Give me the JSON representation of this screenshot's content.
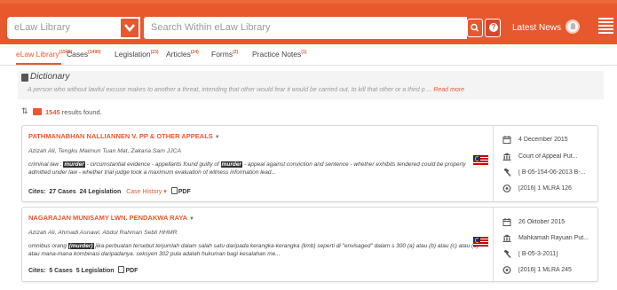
{
  "header": {
    "library_select": "eLaw Library",
    "search_placeholder": "Search Within eLaw Library",
    "latest_news": "Latest News",
    "colors": {
      "brand": "#e8582e"
    }
  },
  "tabs": [
    {
      "label": "eLaw Library",
      "count": "(1545)"
    },
    {
      "label": "Cases",
      "count": "(1490)"
    },
    {
      "label": "Legislation",
      "count": "(23)"
    },
    {
      "label": "Articles",
      "count": "(24)"
    },
    {
      "label": "Forms",
      "count": "(2)"
    },
    {
      "label": "Practice Notes",
      "count": "(1)"
    }
  ],
  "dictionary": {
    "title": "Dictionary",
    "text": "A person who without lawful excuse makes to another a threat, intending that other would fear it would be carried out, to kill that other or a third p ...",
    "read_more": "Read more"
  },
  "results": {
    "count": "1545",
    "suffix": "results found."
  },
  "cards": [
    {
      "title": "PATHMANABHAN NALLIANNEN V. PP & OTHER APPEALS",
      "judges": "Azizah Ali, Tengku Maimun Tuan Mat, Zakaria Sam JJCA",
      "snippet_parts": [
        "criminal law : ",
        "murder",
        " - circumstantial evidence - appellants found guilty of ",
        "murder",
        " - appeal against conviction and sentence - whether exhibits tendered could be properly admitted under law - whether trial judge took a maximum evaluation of witness information lead..."
      ],
      "cites_label": "Cites:",
      "cites_cases": "27 Cases",
      "cites_legislation": "24 Legislation",
      "case_history": "Case History",
      "pdf": "PDF",
      "date": "4 December 2015",
      "court": "Court of Appeal Put...",
      "case_no": "[ B-05-154-06-2013 B-...",
      "citation": "[2016] 1 MLRA 126"
    },
    {
      "title": "NAGARAJAN MUNISAMY LWN. PENDAKWA RAYA",
      "judges": "Azizah Ali, Ahmadi Asnawi, Abdul Rahman Sebli HHMR",
      "snippet_parts": [
        "omnibus orang ",
        "(murder)",
        " jika perbuatan tersebut terjumlah dalam salah satu daripada kerangka-kerangka (limb) seperti di \"envisaged\" dalam s 300 (a) atau (b) atau (c) atau (d) atau mana-mana kombinasi daripadanya. seksyen 302 pula adalah hukuman bagi kesalahan me..."
      ],
      "cites_label": "Cites:",
      "cites_cases": "5 Cases",
      "cites_legislation": "5 Legislation",
      "pdf": "PDF",
      "date": "26 Oktober 2015",
      "court": "Mahkamah Rayuan Put...",
      "case_no": "[ B-05-3-2011]",
      "citation": "[2016] 1 MLRA 245"
    }
  ]
}
